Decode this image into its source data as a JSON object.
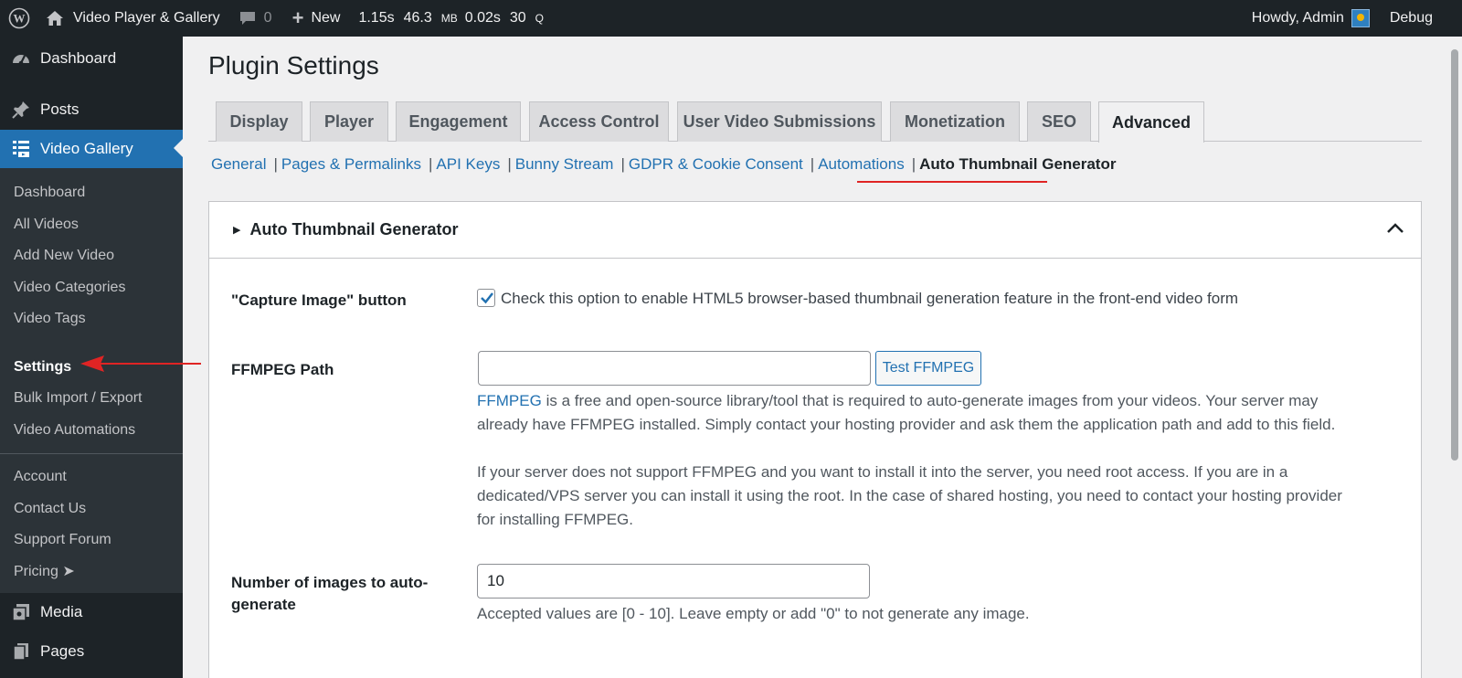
{
  "adminbar": {
    "site_name": "Video Player & Gallery",
    "comments_count": "0",
    "new_label": "New",
    "perf": {
      "time": "1.15s",
      "mem": "46.3",
      "mem_unit": "MB",
      "query_time": "0.02s",
      "queries": "30",
      "queries_unit": "Q"
    },
    "howdy": "Howdy, Admin",
    "debug": "Debug"
  },
  "sidebar": {
    "dashboard": "Dashboard",
    "posts": "Posts",
    "video_gallery": "Video Gallery",
    "submenu": [
      "Dashboard",
      "All Videos",
      "Add New Video",
      "Video Categories",
      "Video Tags",
      "Settings",
      "Bulk Import / Export",
      "Video Automations"
    ],
    "submenu2": [
      "Account",
      "Contact Us",
      "Support Forum",
      "Pricing ➤"
    ],
    "media": "Media",
    "pages": "Pages"
  },
  "page": {
    "title": "Plugin Settings",
    "tabs": [
      "Display",
      "Player",
      "Engagement",
      "Access Control",
      "User Video Submissions",
      "Monetization",
      "SEO",
      "Advanced"
    ],
    "subnav": [
      "General",
      "Pages & Permalinks",
      "API Keys",
      "Bunny Stream",
      "GDPR & Cookie Consent",
      "Automations",
      "Auto Thumbnail Generator"
    ],
    "panel_title": "Auto Thumbnail Generator",
    "capture": {
      "label": "\"Capture Image\" button",
      "checked": true,
      "text": "Check this option to enable HTML5 browser-based thumbnail generation feature in the front-end video form"
    },
    "ffmpeg": {
      "label": "FFMPEG Path",
      "value": "",
      "button": "Test FFMPEG",
      "link": "FFMPEG",
      "desc1_rest": " is a free and open-source library/tool that is required to auto-generate images from your videos. Your server may already have FFMPEG installed. Simply contact your hosting provider and ask them the application path and add to this field.",
      "desc2": "If your server does not support FFMPEG and you want to install it into the server, you need root access. If you are in a dedicated/VPS server you can install it using the root. In the case of shared hosting, you need to contact your hosting provider for installing FFMPEG."
    },
    "num_images": {
      "label": "Number of images to auto-generate",
      "value": "10",
      "desc": "Accepted values are [0 - 10]. Leave empty or add \"0\" to not generate any image."
    }
  },
  "colors": {
    "accent": "#2271b1",
    "annotation": "#e02424",
    "adminbar": "#1d2327"
  }
}
